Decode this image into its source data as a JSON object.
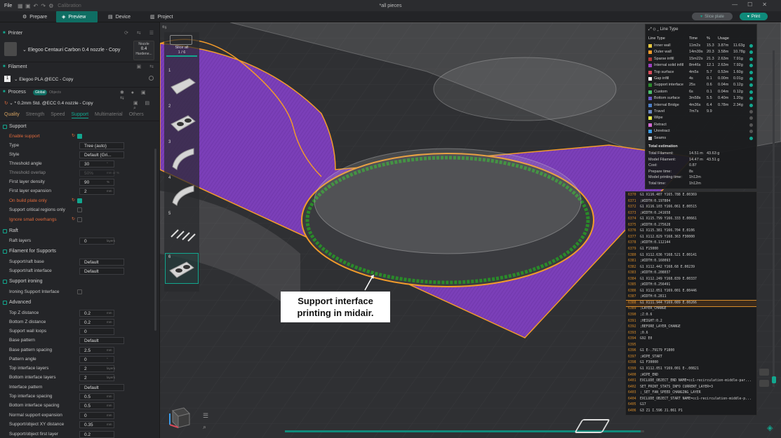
{
  "topbar": {
    "file": "File",
    "calibration": "Calibration",
    "window_title": "*all pieces"
  },
  "tabs": {
    "prepare": "Prepare",
    "preview": "Preview",
    "device": "Device",
    "project": "Project"
  },
  "actions": {
    "slice_plate": "Slice plate",
    "print": "Print"
  },
  "printer": {
    "header": "Printer",
    "name": "Elegoo Centauri Carbon 0.4 nozzle - Copy",
    "nozzle_label": "Nozzle",
    "nozzle_value": "0.4",
    "hardened": "Hardene..."
  },
  "filament": {
    "header": "Filament",
    "slot": "1",
    "name": "Elegoo PLA @ECC - Copy"
  },
  "process": {
    "header": "Process",
    "global": "Global",
    "objects": "Objects",
    "profile": "* 0.2mm Std. @ECC 0.4 nozzle - Copy"
  },
  "process_tabs": [
    "Quality",
    "Strength",
    "Speed",
    "Support",
    "Multimaterial",
    "Others"
  ],
  "sections": {
    "support": "Support",
    "raft": "Raft",
    "filament_for_supports": "Filament for Supports",
    "support_ironing": "Support ironing",
    "advanced": "Advanced"
  },
  "rows": {
    "enable_support": "Enable support",
    "type": {
      "label": "Type",
      "value": "Tree (auto)"
    },
    "style": {
      "label": "Style",
      "value": "Default (Gri..."
    },
    "threshold_angle": {
      "label": "Threshold angle",
      "value": "30",
      "unit": "°"
    },
    "threshold_overlap": {
      "label": "Threshold overlap",
      "value": "50%",
      "unit": "mm or %"
    },
    "first_layer_density": {
      "label": "First layer density",
      "value": "90",
      "unit": "%"
    },
    "first_layer_expansion": {
      "label": "First layer expansion",
      "value": "2",
      "unit": "mm"
    },
    "on_build_plate_only": "On build plate only",
    "support_critical": "Support critical regions only",
    "ignore_small": "Ignore small overhangs",
    "raft_layers": {
      "label": "Raft layers",
      "value": "0",
      "unit": "layers"
    },
    "raft_base": {
      "label": "Support/raft base",
      "value": "Default"
    },
    "raft_interface": {
      "label": "Support/raft interface",
      "value": "Default"
    },
    "ironing_interface": "Ironing Support Interface",
    "top_z": {
      "label": "Top Z distance",
      "value": "0.2",
      "unit": "mm"
    },
    "bottom_z": {
      "label": "Bottom Z distance",
      "value": "0.2",
      "unit": "mm"
    },
    "wall_loops": {
      "label": "Support wall loops",
      "value": "0"
    },
    "base_pattern": {
      "label": "Base pattern",
      "value": "Default"
    },
    "base_spacing": {
      "label": "Base pattern spacing",
      "value": "2.5",
      "unit": "mm"
    },
    "pattern_angle": {
      "label": "Pattern angle",
      "value": "0",
      "unit": "°"
    },
    "top_iface_layers": {
      "label": "Top interface layers",
      "value": "2",
      "unit": "layers"
    },
    "bot_iface_layers": {
      "label": "Bottom interface layers",
      "value": "2",
      "unit": "layers"
    },
    "iface_pattern": {
      "label": "Interface pattern",
      "value": "Default"
    },
    "top_iface_spacing": {
      "label": "Top interface spacing",
      "value": "0.5",
      "unit": "mm"
    },
    "bot_iface_spacing": {
      "label": "Bottom interface spacing",
      "value": "0.5",
      "unit": "mm"
    },
    "normal_exp": {
      "label": "Normal support expansion",
      "value": "0",
      "unit": "mm"
    },
    "xy_distance": {
      "label": "Support/object XY distance",
      "value": "0.35",
      "unit": "mm"
    },
    "first_layer_gap": {
      "label": "Support/object first layer",
      "value": "0.2"
    }
  },
  "thumbs": {
    "slice_all": "Slice all",
    "count": "1 / 6",
    "items": [
      "1",
      "2",
      "3",
      "4",
      "5",
      "6"
    ]
  },
  "line_type": {
    "title": "Line Type",
    "headers": [
      "Line Type",
      "Time",
      "%",
      "Usage"
    ],
    "rows": [
      {
        "name": "Inner wall",
        "time": "11m2s",
        "pct": "15.3",
        "u1": "3.87m",
        "u2": "11.63g",
        "color": "#e8c940",
        "on": true
      },
      {
        "name": "Outer wall",
        "time": "14m39s",
        "pct": "20.3",
        "u1": "3.58m",
        "u2": "10.78g",
        "color": "#f29b2a",
        "on": true
      },
      {
        "name": "Sparse infill",
        "time": "15m22s",
        "pct": "21.3",
        "u1": "2.63m",
        "u2": "7.91g",
        "color": "#b33a3a",
        "on": true
      },
      {
        "name": "Internal solid infill",
        "time": "8m46s",
        "pct": "12.1",
        "u1": "2.63m",
        "u2": "7.92g",
        "color": "#9c3fbf",
        "on": true
      },
      {
        "name": "Top surface",
        "time": "4m5s",
        "pct": "5.7",
        "u1": "0.53m",
        "u2": "1.60g",
        "color": "#d84a5a",
        "on": true
      },
      {
        "name": "Gap infill",
        "time": "4s",
        "pct": "0.1",
        "u1": "0.00m",
        "u2": "0.01g",
        "color": "#ffffff",
        "on": true
      },
      {
        "name": "Support interface",
        "time": "25s",
        "pct": "0.6",
        "u1": "0.04m",
        "u2": "0.12g",
        "color": "#2a8a2a",
        "on": true
      },
      {
        "name": "Custom",
        "time": "6s",
        "pct": "0.1",
        "u1": "0.04m",
        "u2": "0.12g",
        "color": "#4bbf6a",
        "on": true
      },
      {
        "name": "Bottom surface",
        "time": "3m58s",
        "pct": "5.5",
        "u1": "0.40m",
        "u2": "1.20g",
        "color": "#6a5acd",
        "on": true
      },
      {
        "name": "Internal Bridge",
        "time": "4m36s",
        "pct": "6.4",
        "u1": "0.78m",
        "u2": "2.34g",
        "color": "#4a7fc8",
        "on": true
      },
      {
        "name": "Travel",
        "time": "7m7s",
        "pct": "9.9",
        "u1": "",
        "u2": "",
        "color": "#6a88c2",
        "on": false
      },
      {
        "name": "Wipe",
        "time": "",
        "pct": "",
        "u1": "",
        "u2": "",
        "color": "#e8e84a",
        "on": false
      },
      {
        "name": "Retract",
        "time": "",
        "pct": "",
        "u1": "",
        "u2": "",
        "color": "#d46ad4",
        "on": false
      },
      {
        "name": "Unretract",
        "time": "",
        "pct": "",
        "u1": "",
        "u2": "",
        "color": "#3a9be8",
        "on": false
      },
      {
        "name": "Seams",
        "time": "",
        "pct": "",
        "u1": "",
        "u2": "",
        "color": "#cccccc",
        "on": true
      }
    ],
    "estimation_title": "Total estimation",
    "estimation": [
      {
        "k": "Total Filament:",
        "v": "14.51 m",
        "v2": "43.63 g"
      },
      {
        "k": "Model Filament:",
        "v": "14.47 m",
        "v2": "43.51 g"
      },
      {
        "k": "Cost:",
        "v": "0.87",
        "v2": ""
      },
      {
        "k": "Prepare time:",
        "v": "8s",
        "v2": ""
      },
      {
        "k": "Model printing time:",
        "v": "1h12m",
        "v2": ""
      },
      {
        "k": "Total time:",
        "v": "1h12m",
        "v2": ""
      }
    ]
  },
  "gcode": [
    {
      "n": "6370",
      "c": "G1 X116.407 Y165.788 E.00369"
    },
    {
      "n": "6371",
      "c": ";WIDTH:0.197804"
    },
    {
      "n": "6372",
      "c": "G1 X116.103 Y166.061 E.00515"
    },
    {
      "n": "6373",
      "c": ";WIDTH:0.241658"
    },
    {
      "n": "6374",
      "c": "G1 X115.799 Y166.333 E.00661"
    },
    {
      "n": "6375",
      "c": ";WIDTH:0.275628"
    },
    {
      "n": "6376",
      "c": "G1 X115.381 Y166.704 E.0106"
    },
    {
      "n": "6377",
      "c": "G1 X112.829 Y168.363 F30000"
    },
    {
      "n": "6378",
      "c": ";WIDTH:0.112144"
    },
    {
      "n": "6379",
      "c": "G1 F15000"
    },
    {
      "n": "6380",
      "c": "G1 X112.636 Y168.521 E.00141"
    },
    {
      "n": "6381",
      "c": ";WIDTH:0.160093"
    },
    {
      "n": "6382",
      "c": "G1 X112.442 Y168.68 E.00239"
    },
    {
      "n": "6383",
      "c": ";WIDTH:0.208037"
    },
    {
      "n": "6384",
      "c": "G1 X112.249 Y168.839 E.00337"
    },
    {
      "n": "6385",
      "c": ";WIDTH:0.256491"
    },
    {
      "n": "6386",
      "c": "G1 X112.051 Y169.001 E.00446"
    },
    {
      "n": "6387",
      "c": ";WIDTH:0.2811"
    },
    {
      "n": "6388",
      "c": "G1 X111.944 Y169.089 E.00266",
      "hl": true
    },
    {
      "n": "6389",
      "c": ";LAYER_CHANGE"
    },
    {
      "n": "6390",
      "c": ";Z:0.6"
    },
    {
      "n": "6391",
      "c": ";HEIGHT:0.2"
    },
    {
      "n": "6392",
      "c": ";BEFORE_LAYER_CHANGE"
    },
    {
      "n": "6393",
      "c": ";0.6"
    },
    {
      "n": "6394",
      "c": "G92 E0"
    },
    {
      "n": "6395",
      "c": ""
    },
    {
      "n": "6396",
      "c": "G1 E-.79179 F1800"
    },
    {
      "n": "6397",
      "c": ";WIPE_START"
    },
    {
      "n": "6398",
      "c": "G1 F30000"
    },
    {
      "n": "6399",
      "c": "G1 X112.051 Y169.001 E-.00821"
    },
    {
      "n": "6400",
      "c": ";WIPE_END"
    },
    {
      "n": "6401",
      "c": "EXCLUDE_OBJECT_END NAME=cc1-recirculation-middle-par..."
    },
    {
      "n": "6402",
      "c": "SET_PRINT_STATS_INFO CURRENT_LAYER=3"
    },
    {
      "n": "6403",
      "c": ";_SET_FAN_SPEED_CHANGING_LAYER"
    },
    {
      "n": "6404",
      "c": "EXCLUDE_OBJECT_START NAME=cc1-recirculation-middle-p..."
    },
    {
      "n": "6405",
      "c": "G17"
    },
    {
      "n": "6406",
      "c": "G3 Z1 I.596 J1.061 P1"
    }
  ],
  "callout": {
    "line1": "Support interface",
    "line2": "printing in midair."
  },
  "progress": 0.99,
  "colors": {
    "accent": "#12a78f",
    "purple": "#7b3fb8",
    "outline": "#f29b2a",
    "support": "#2a8a2a"
  }
}
